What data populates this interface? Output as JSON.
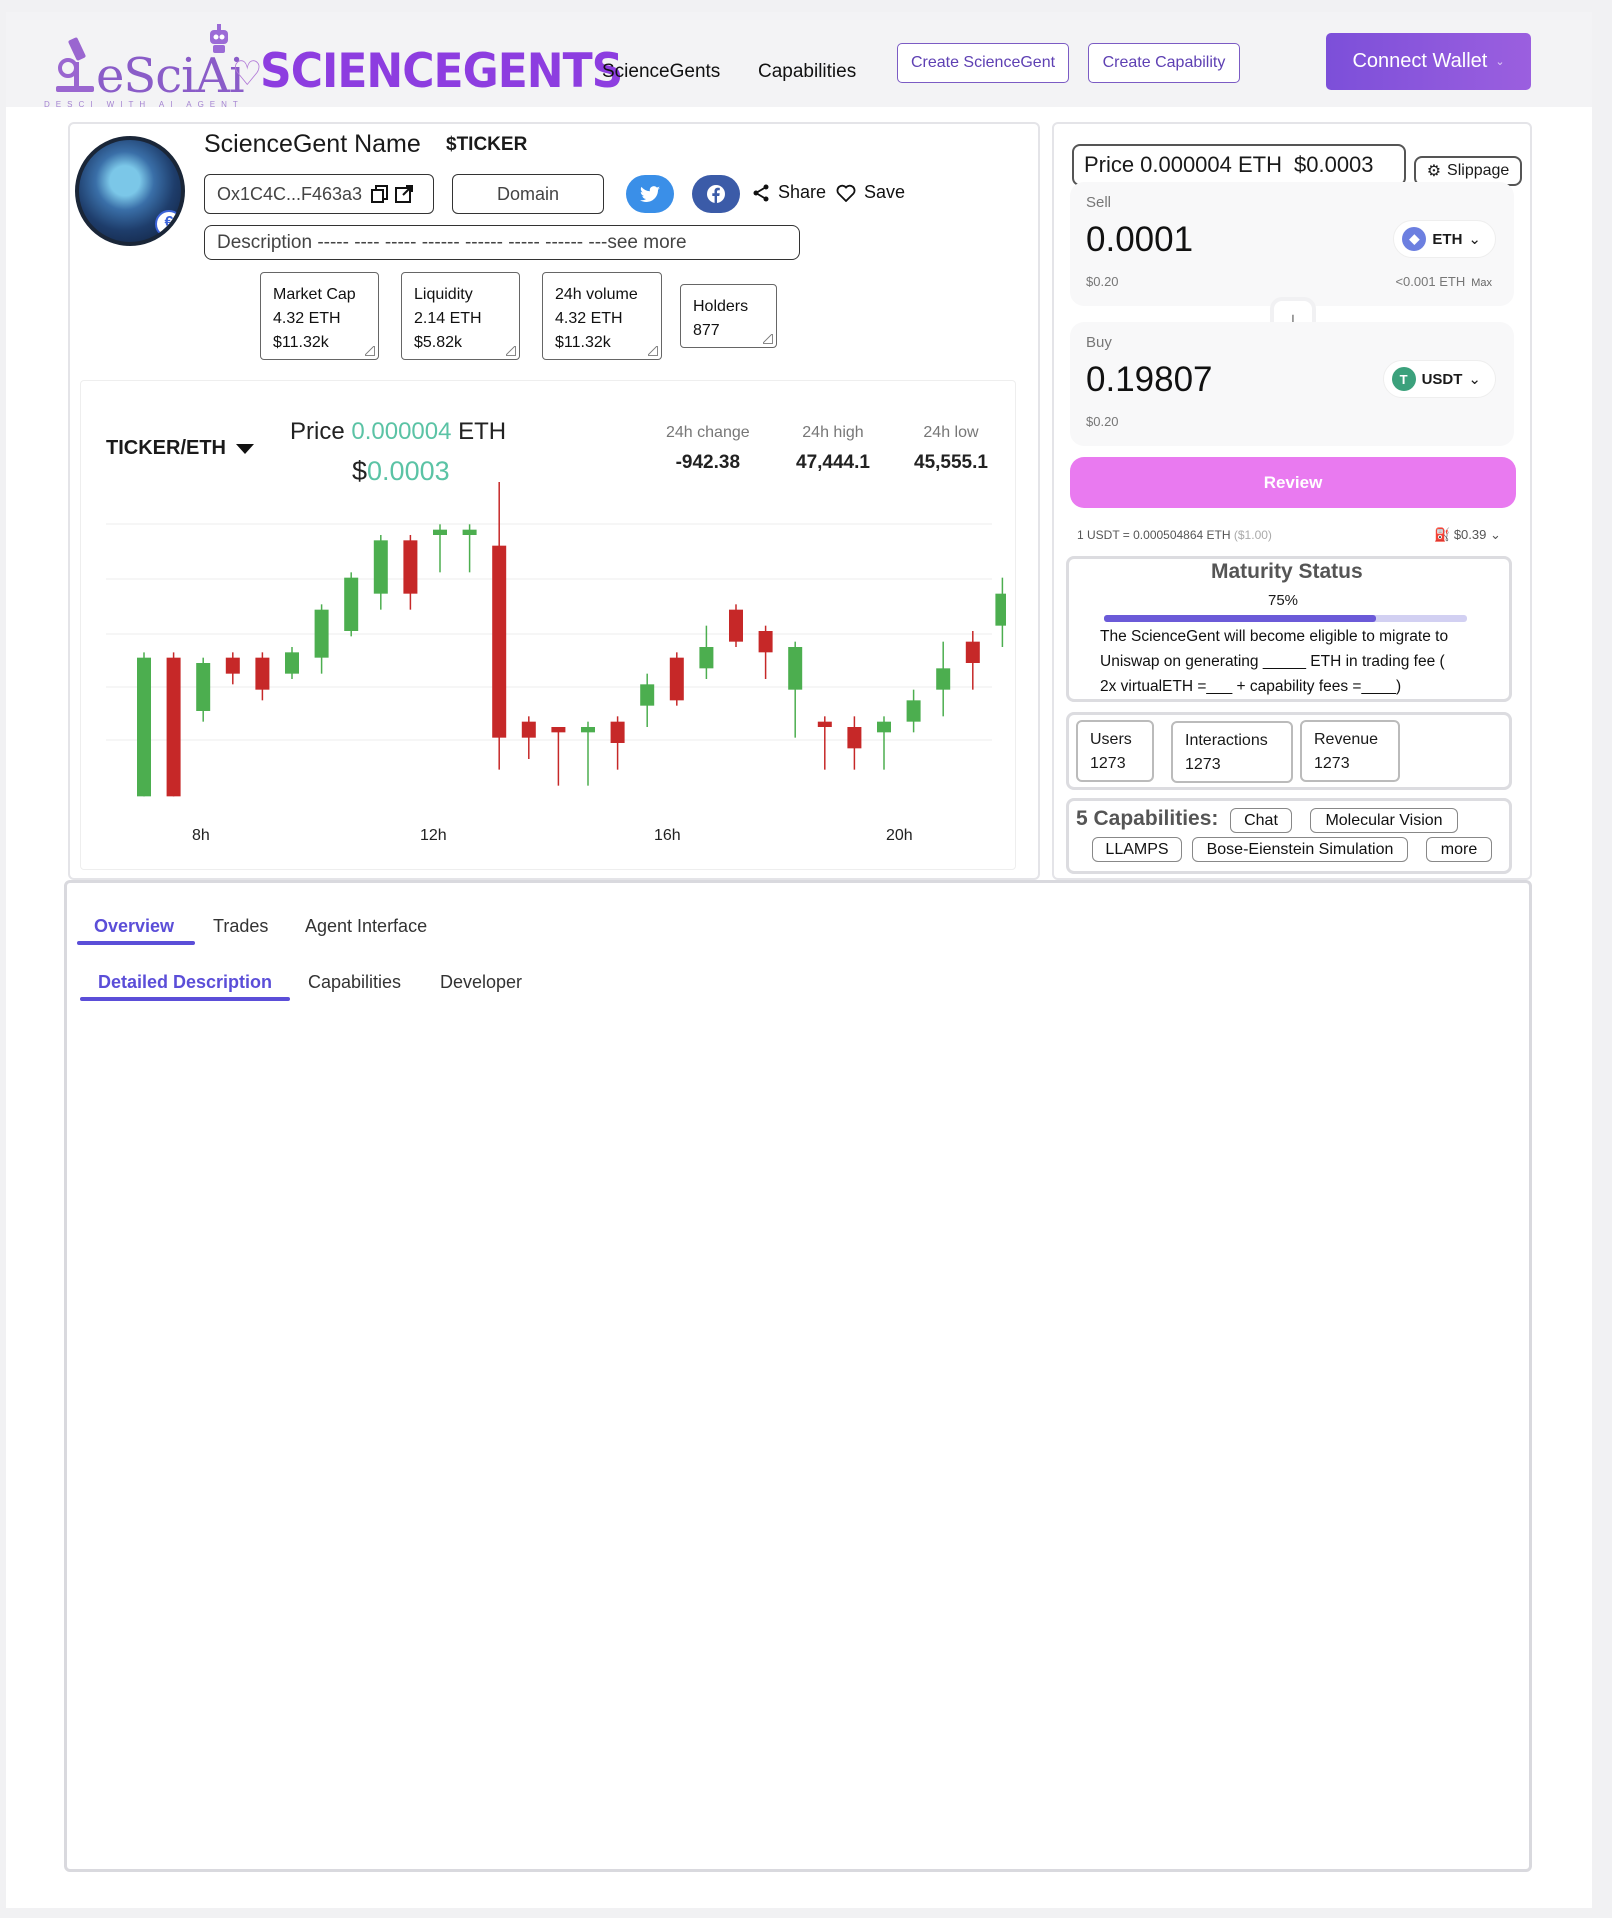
{
  "header": {
    "logo_text": "eSciAi",
    "logo_tagline": "DESCI WITH AI AGENT",
    "brand_text": "SCIENCEGENTS",
    "nav": [
      "ScienceGents",
      "Capabilities"
    ],
    "create_sciencegent": "Create ScienceGent",
    "create_capability": "Create Capability",
    "connect_wallet": "Connect Wallet"
  },
  "agent": {
    "name": "ScienceGent Name",
    "ticker": "$TICKER",
    "address": "Ox1C4C...F463a3",
    "domain": "Domain",
    "share": "Share",
    "save": "Save",
    "description": "Description ----- ---- ----- ------ ------  ----- ------ ---see more"
  },
  "stats": [
    {
      "label": "Market Cap",
      "line1": "4.32 ETH",
      "line2": "$11.32k"
    },
    {
      "label": "Liquidity",
      "line1": "2.14 ETH",
      "line2": "$5.82k"
    },
    {
      "label": "24h volume",
      "line1": "4.32 ETH",
      "line2": "$11.32k"
    },
    {
      "label": "Holders",
      "line1": "877",
      "line2": ""
    }
  ],
  "chart_header": {
    "pair": "TICKER/ETH",
    "price_label": "Price",
    "price_eth": "0.000004",
    "eth_unit": "ETH",
    "usd_sign": "$",
    "price_usd": "0.0003",
    "change_label": "24h change",
    "change_value": "-942.38",
    "high_label": "24h high",
    "high_value": "47,444.1",
    "low_label": "24h low",
    "low_value": "45,555.1"
  },
  "chart_data": {
    "type": "candlestick",
    "x_tick_labels": [
      "8h",
      "12h",
      "16h",
      "20h"
    ],
    "up_color": "#4cae4f",
    "down_color": "#c62828",
    "ylim": [
      0,
      60
    ],
    "candles": [
      {
        "o": 2,
        "c": 28,
        "h": 29,
        "l": 2
      },
      {
        "o": 28,
        "c": 2,
        "h": 29,
        "l": 2
      },
      {
        "o": 18,
        "c": 27,
        "h": 28,
        "l": 16
      },
      {
        "o": 28,
        "c": 25,
        "h": 29,
        "l": 23
      },
      {
        "o": 28,
        "c": 22,
        "h": 29,
        "l": 20
      },
      {
        "o": 25,
        "c": 29,
        "h": 30,
        "l": 24
      },
      {
        "o": 28,
        "c": 37,
        "h": 38,
        "l": 25
      },
      {
        "o": 33,
        "c": 43,
        "h": 44,
        "l": 32
      },
      {
        "o": 40,
        "c": 50,
        "h": 51,
        "l": 37
      },
      {
        "o": 50,
        "c": 40,
        "h": 51,
        "l": 37
      },
      {
        "o": 51,
        "c": 52,
        "h": 53,
        "l": 44
      },
      {
        "o": 51,
        "c": 52,
        "h": 53,
        "l": 44
      },
      {
        "o": 49,
        "c": 13,
        "h": 61,
        "l": 7
      },
      {
        "o": 16,
        "c": 13,
        "h": 17,
        "l": 9
      },
      {
        "o": 15,
        "c": 14,
        "h": 15,
        "l": 4
      },
      {
        "o": 14,
        "c": 15,
        "h": 16,
        "l": 4
      },
      {
        "o": 16,
        "c": 12,
        "h": 17,
        "l": 7
      },
      {
        "o": 19,
        "c": 23,
        "h": 25,
        "l": 15
      },
      {
        "o": 28,
        "c": 20,
        "h": 29,
        "l": 19
      },
      {
        "o": 26,
        "c": 30,
        "h": 34,
        "l": 24
      },
      {
        "o": 37,
        "c": 31,
        "h": 38,
        "l": 30
      },
      {
        "o": 33,
        "c": 29,
        "h": 34,
        "l": 24
      },
      {
        "o": 22,
        "c": 30,
        "h": 31,
        "l": 13
      },
      {
        "o": 16,
        "c": 15,
        "h": 17,
        "l": 7
      },
      {
        "o": 15,
        "c": 11,
        "h": 17,
        "l": 7
      },
      {
        "o": 14,
        "c": 16,
        "h": 17,
        "l": 7
      },
      {
        "o": 16,
        "c": 20,
        "h": 22,
        "l": 14
      },
      {
        "o": 22,
        "c": 26,
        "h": 31,
        "l": 17
      },
      {
        "o": 31,
        "c": 27,
        "h": 33,
        "l": 22
      },
      {
        "o": 34,
        "c": 40,
        "h": 43,
        "l": 30
      }
    ]
  },
  "swap": {
    "price_label": "Price",
    "price_eth": "0.000004 ETH",
    "price_usd": "$0.0003",
    "slippage": "Slippage",
    "sell_label": "Sell",
    "sell_amount": "0.0001",
    "sell_usd": "$0.20",
    "sell_token": "ETH",
    "sell_balance": "<0.001 ETH",
    "max": "Max",
    "buy_label": "Buy",
    "buy_amount": "0.19807",
    "buy_usd": "$0.20",
    "buy_token": "USDT",
    "review": "Review",
    "rate_text": "1 USDT = 0.000504864 ETH",
    "rate_usd": "($1.00)",
    "gas": "$0.39"
  },
  "maturity": {
    "title": "Maturity Status",
    "percent_label": "75%",
    "progress": 0.75,
    "line1": "The ScienceGent will become eligible to migrate to",
    "line2": "Uniswap on generating _____ ETH in trading fee (",
    "line3": "2x virtualETH =___  + capability fees =____)"
  },
  "usage": [
    {
      "label": "Users",
      "value": "1273"
    },
    {
      "label": "Interactions",
      "value": "1273"
    },
    {
      "label": "Revenue",
      "value": "1273"
    }
  ],
  "capabilities": {
    "title": "5 Capabilities:",
    "chips": [
      "Chat",
      "Molecular Vision",
      "LLAMPS",
      "Bose-Eienstein Simulation",
      "more"
    ]
  },
  "tabs": {
    "main": [
      "Overview",
      "Trades",
      "Agent Interface"
    ],
    "sub": [
      "Detailed Description",
      "Capabilities",
      "Developer"
    ]
  }
}
